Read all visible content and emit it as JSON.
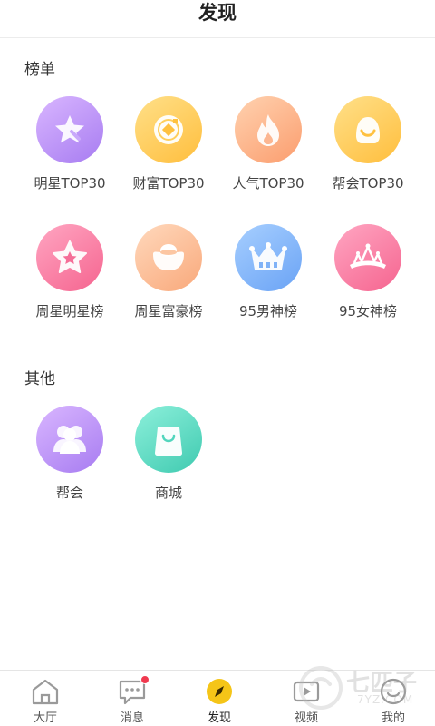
{
  "header": {
    "title": "发现"
  },
  "sections": {
    "rankings": {
      "title": "榜单",
      "items": [
        {
          "label": "明星TOP30",
          "icon": "star-icon",
          "color": "#b58af5"
        },
        {
          "label": "财富TOP30",
          "icon": "coin-icon",
          "color": "#ffcb55"
        },
        {
          "label": "人气TOP30",
          "icon": "flame-icon",
          "color": "#fcae82"
        },
        {
          "label": "帮会TOP30",
          "icon": "guild-mask-icon",
          "color": "#ffcb55"
        },
        {
          "label": "周星明星榜",
          "icon": "badge-star-icon",
          "color": "#f77ca2"
        },
        {
          "label": "周星富豪榜",
          "icon": "gold-ingot-icon",
          "color": "#fbb58c"
        },
        {
          "label": "95男神榜",
          "icon": "crown-icon",
          "color": "#7fb2f7"
        },
        {
          "label": "95女神榜",
          "icon": "tiara-icon",
          "color": "#f77ca2"
        }
      ]
    },
    "others": {
      "title": "其他",
      "items": [
        {
          "label": "帮会",
          "icon": "group-icon",
          "color": "#b58af5"
        },
        {
          "label": "商城",
          "icon": "shopping-bag-icon",
          "color": "#52d6bd"
        }
      ]
    }
  },
  "tabbar": {
    "active": "发现",
    "tabs": [
      {
        "label": "大厅",
        "icon": "house-icon"
      },
      {
        "label": "消息",
        "icon": "chat-icon",
        "badge": true
      },
      {
        "label": "发现",
        "icon": "compass-icon"
      },
      {
        "label": "视频",
        "icon": "video-icon"
      },
      {
        "label": "我的",
        "icon": "profile-icon"
      }
    ]
  },
  "watermark": {
    "text": "七匹子",
    "sub": "7YZ.COM"
  },
  "colors": {
    "accent": "#f5c518",
    "badge": "#f0394f"
  }
}
